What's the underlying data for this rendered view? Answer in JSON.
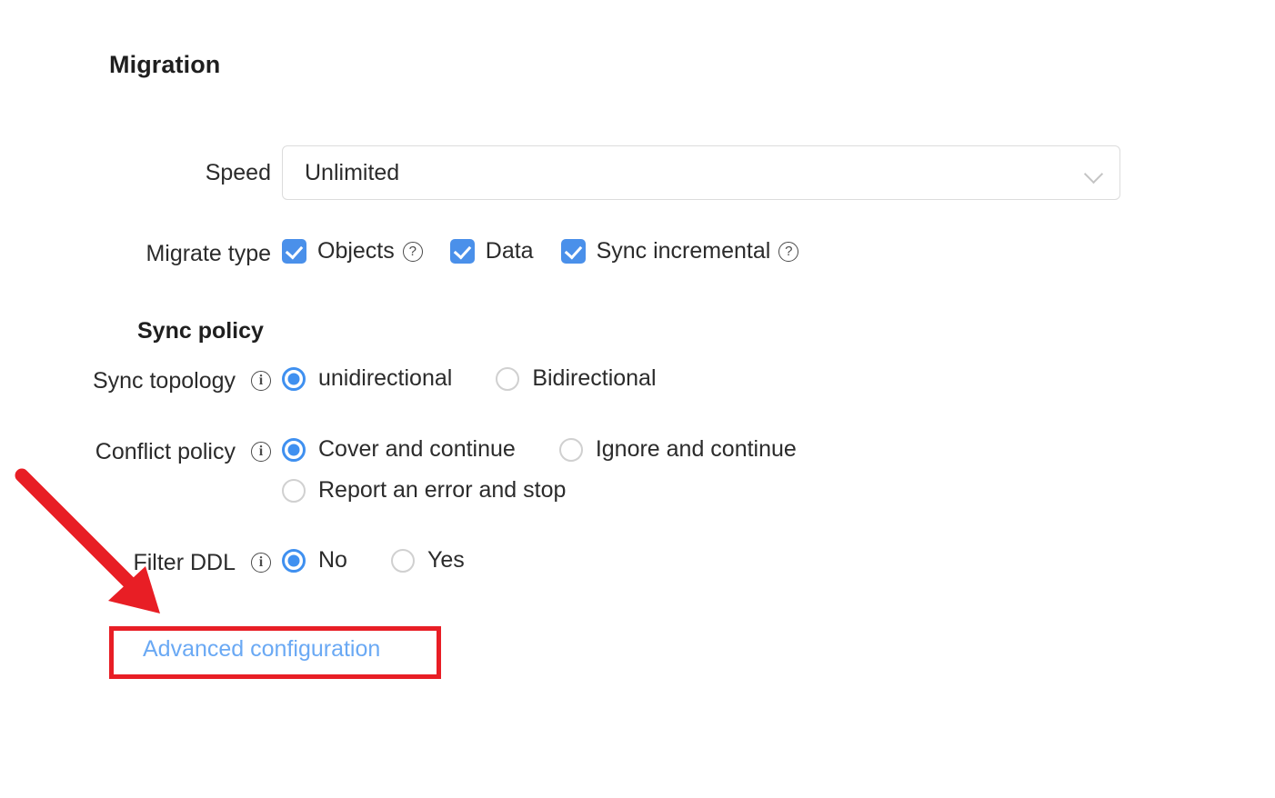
{
  "page": {
    "title": "Migration"
  },
  "speed": {
    "label": "Speed",
    "value": "Unlimited",
    "chevron_icon": "chevron-down-icon"
  },
  "migrate_type": {
    "label": "Migrate type",
    "options": [
      {
        "label": "Objects",
        "checked": true,
        "help_icon": "help-circle-icon",
        "help_glyph": "?"
      },
      {
        "label": "Data",
        "checked": true,
        "help_icon": null,
        "help_glyph": ""
      },
      {
        "label": "Sync incremental",
        "checked": true,
        "help_icon": "help-circle-icon",
        "help_glyph": "?"
      }
    ]
  },
  "sync_policy": {
    "heading": "Sync policy",
    "sync_topology": {
      "label": "Sync topology",
      "info_icon": "info-circle-icon",
      "info_glyph": "i",
      "options": [
        {
          "label": "unidirectional",
          "selected": true
        },
        {
          "label": "Bidirectional",
          "selected": false
        }
      ]
    },
    "conflict_policy": {
      "label": "Conflict policy",
      "info_icon": "info-circle-icon",
      "info_glyph": "i",
      "options": [
        {
          "label": "Cover and continue",
          "selected": true
        },
        {
          "label": "Ignore and continue",
          "selected": false
        },
        {
          "label": "Report an error and stop",
          "selected": false
        }
      ]
    },
    "filter_ddl": {
      "label": "Filter DDL",
      "info_icon": "info-circle-icon",
      "info_glyph": "i",
      "options": [
        {
          "label": "No",
          "selected": true
        },
        {
          "label": "Yes",
          "selected": false
        }
      ]
    }
  },
  "advanced": {
    "link_label": "Advanced configuration"
  },
  "annotations": {
    "highlight_color": "#e81e25",
    "arrow_color": "#e81e25"
  },
  "colors": {
    "accent_blue": "#4a90ea",
    "radio_blue": "#3f90f0",
    "link_blue": "#6aa9f4",
    "border_gray": "#dcdcdc"
  }
}
